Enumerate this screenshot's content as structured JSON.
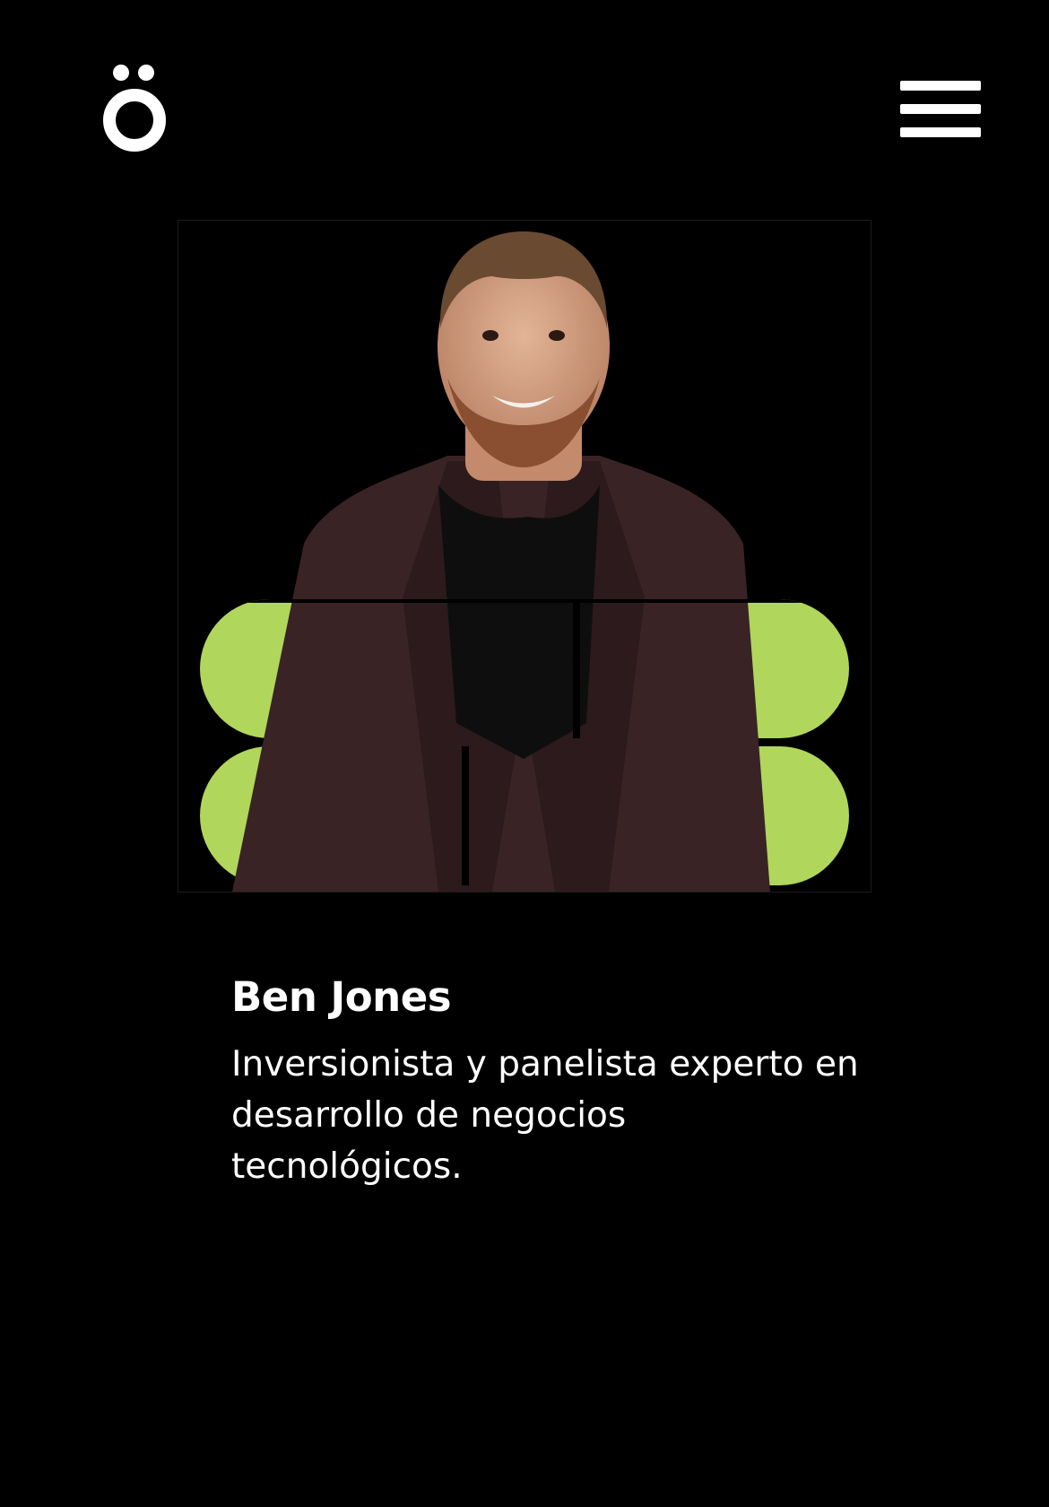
{
  "header": {
    "logo_icon": "o-umlaut-logo-icon",
    "menu_icon": "hamburger-menu-icon"
  },
  "hero": {
    "image_subject": "portrait-photo",
    "accent_color": "#b0d65c",
    "background_color": "#000000"
  },
  "profile": {
    "name": "Ben Jones",
    "bio": "Inversionista y panelista experto en desarrollo de negocios tecnológicos."
  }
}
